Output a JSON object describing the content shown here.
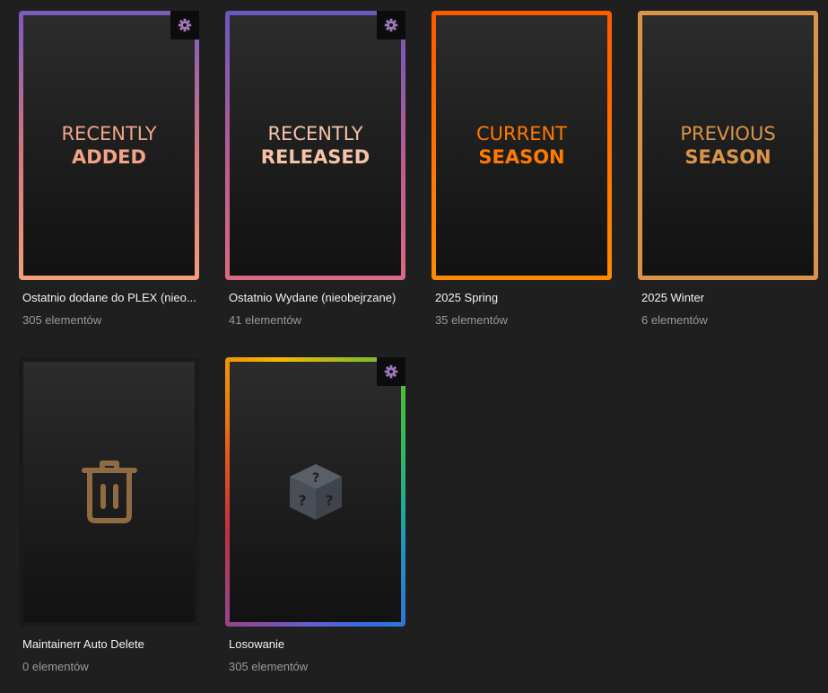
{
  "cards": [
    {
      "line1": "RECENTLY",
      "line2": "ADDED",
      "title": "Ostatnio dodane do PLEX (nieo...",
      "count": "305 elementów",
      "text_color": "#f2a487",
      "border_colors": [
        "#7a5bbf",
        "#d9787f",
        "#f0a07a"
      ]
    },
    {
      "line1": "RECENTLY",
      "line2": "RELEASED",
      "title": "Ostatnio Wydane (nieobejrzane)",
      "count": "41 elementów",
      "text_color": "#f6c3a8",
      "border_colors": [
        "#6a58bf",
        "#c05d8f",
        "#d96a84"
      ]
    },
    {
      "line1": "CURRENT",
      "line2": "SEASON",
      "title": "2025 Spring",
      "count": "35 elementów",
      "text_color": "#ff7a00",
      "border_colors": [
        "#ff5a00",
        "#ff8a00"
      ]
    },
    {
      "line1": "PREVIOUS",
      "line2": "SEASON",
      "title": "2025 Winter",
      "count": "6 elementów",
      "text_color": "#d9944a",
      "border_colors": [
        "#d9944a",
        "#d9944a"
      ]
    },
    {
      "title": "Maintainerr Auto Delete",
      "count": "0 elementów",
      "icon": "trash-icon",
      "icon_color": "#8f6a43"
    },
    {
      "title": "Losowanie",
      "count": "305 elementów",
      "icon": "mystery-dice-icon",
      "icon_color": "#4a4f57",
      "border_colors": [
        "#f5b800",
        "#3fbf3f",
        "#2f6fe0",
        "#c03040"
      ]
    }
  ],
  "gear_color": "#a07ac0",
  "background": "#1f1f1f"
}
